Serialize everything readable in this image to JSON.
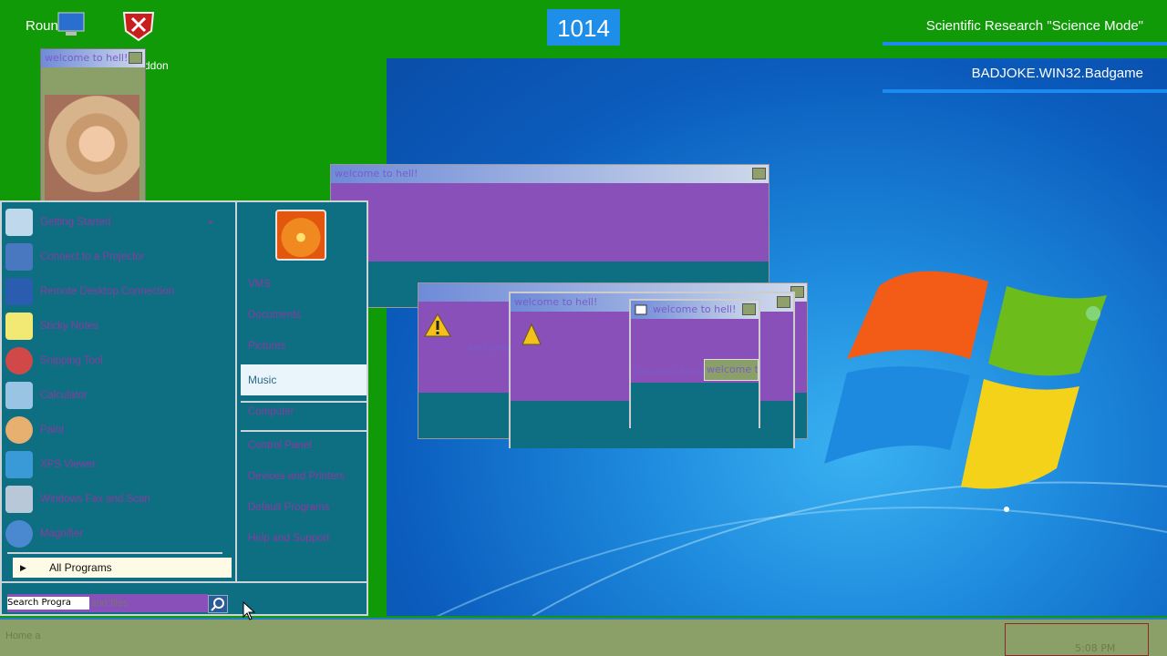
{
  "overlay": {
    "round": "Round 1",
    "counter": "1014",
    "mode_label": "Scientific Research \"Science Mode\"",
    "malware_label": "BADJOKE.WIN32.Badgame"
  },
  "desktop": {
    "addon_label": "ddon"
  },
  "windows": {
    "title": "welcome to hell!",
    "body_text": "welcome to hell!",
    "button_text": "welcome to hell!",
    "partial_text": "welcome"
  },
  "start_menu": {
    "programs": [
      {
        "label": "Getting Started",
        "icon": "getting-started-icon"
      },
      {
        "label": "Connect to a Projector",
        "icon": "projector-icon"
      },
      {
        "label": "Remote Desktop Connection",
        "icon": "remote-desktop-icon"
      },
      {
        "label": "Sticky Notes",
        "icon": "sticky-notes-icon"
      },
      {
        "label": "Snipping Tool",
        "icon": "snipping-tool-icon"
      },
      {
        "label": "Calculator",
        "icon": "calculator-icon"
      },
      {
        "label": "Paint",
        "icon": "paint-icon"
      },
      {
        "label": "XPS Viewer",
        "icon": "xps-viewer-icon"
      },
      {
        "label": "Windows Fax and Scan",
        "icon": "fax-icon"
      },
      {
        "label": "Magnifier",
        "icon": "magnifier-icon"
      }
    ],
    "all_programs": "All Programs",
    "right_links": [
      "VMS",
      "Documents",
      "Pictures",
      "Music",
      "Computer",
      "Control Panel",
      "Devices and Printers",
      "Default Programs",
      "Help and Support"
    ],
    "search_placeholder": "Search programs and files",
    "search_glitch": "Search Progra"
  },
  "taskbar": {
    "left_text": "Home a",
    "right_text": "5:08 PM"
  }
}
